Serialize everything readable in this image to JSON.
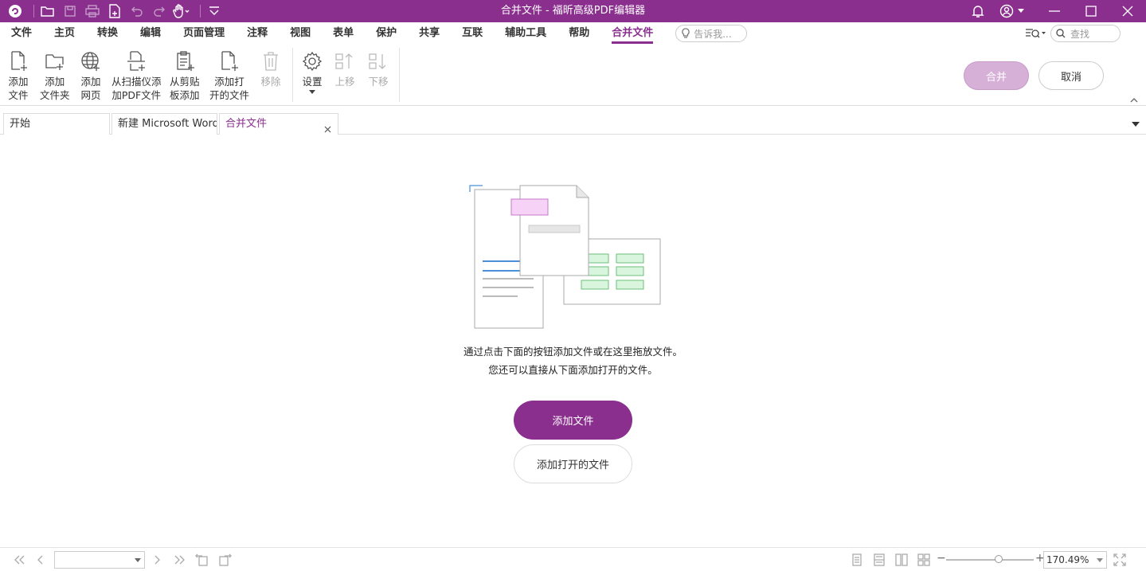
{
  "window": {
    "title": "合并文件 - 福昕高级PDF编辑器"
  },
  "menu": {
    "items": [
      "文件",
      "主页",
      "转换",
      "编辑",
      "页面管理",
      "注释",
      "视图",
      "表单",
      "保护",
      "共享",
      "互联",
      "辅助工具",
      "帮助",
      "合并文件"
    ],
    "active": "合并文件",
    "tell_me_placeholder": "告诉我...",
    "search_placeholder": "查找"
  },
  "ribbon": {
    "add_file": {
      "line1": "添加",
      "line2": "文件"
    },
    "add_folder": {
      "line1": "添加",
      "line2": "文件夹"
    },
    "add_webpage": {
      "line1": "添加",
      "line2": "网页"
    },
    "from_scanner": {
      "line1": "从扫描仪添",
      "line2": "加PDF文件"
    },
    "from_clipboard": {
      "line1": "从剪贴",
      "line2": "板添加"
    },
    "add_opened": {
      "line1": "添加打",
      "line2": "开的文件"
    },
    "remove": {
      "line1": "移除"
    },
    "settings": {
      "line1": "设置"
    },
    "move_up": {
      "line1": "上移"
    },
    "move_down": {
      "line1": "下移"
    },
    "merge_label": "合并",
    "cancel_label": "取消"
  },
  "tabs": [
    {
      "label": "开始"
    },
    {
      "label": "新建 Microsoft Word..."
    },
    {
      "label": "合并文件"
    }
  ],
  "main": {
    "hint_line1": "通过点击下面的按钮添加文件或在这里拖放文件。",
    "hint_line2": "您还可以直接从下面添加打开的文件。",
    "add_file_button": "添加文件",
    "add_opened_button": "添加打开的文件"
  },
  "status": {
    "page_value": "",
    "zoom_value": "170.49%",
    "zoom_level_fraction": 0.55
  },
  "colors": {
    "accent": "#8b2f8f",
    "merge_disabled": "#d7b0d8"
  }
}
